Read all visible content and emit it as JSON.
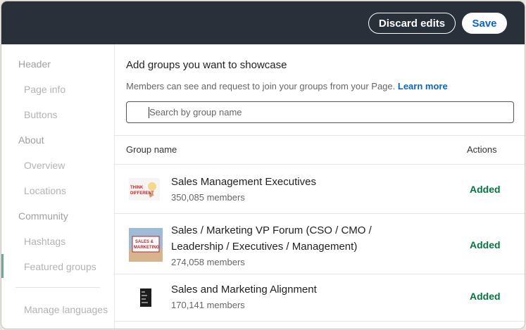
{
  "toolbar": {
    "discard_label": "Discard edits",
    "save_label": "Save"
  },
  "sidebar": {
    "sections": [
      {
        "label": "Header",
        "items": [
          "Page info",
          "Buttons"
        ]
      },
      {
        "label": "About",
        "items": [
          "Overview",
          "Locations"
        ]
      },
      {
        "label": "Community",
        "items": [
          "Hashtags",
          "Featured groups"
        ]
      }
    ],
    "footer_item": "Manage languages",
    "active_item": "Featured groups"
  },
  "main": {
    "title": "Add groups you want to showcase",
    "description": "Members can see and request to join your groups from your Page.",
    "learn_more": "Learn more",
    "search": {
      "placeholder": "Search by group name",
      "value": ""
    },
    "table": {
      "col_name": "Group name",
      "col_actions": "Actions",
      "rows": [
        {
          "name": "Sales Management Executives",
          "members": "350,085 members",
          "action": "Added",
          "thumb_text_1": "THINK",
          "thumb_text_2": "DIFFERENT"
        },
        {
          "name": "Sales / Marketing VP Forum (CSO / CMO / Leadership / Executives / Management)",
          "members": "274,058 members",
          "action": "Added",
          "thumb_text_1": "SALES &",
          "thumb_text_2": "MARKETING"
        },
        {
          "name": "Sales and Marketing Alignment",
          "members": "170,141 members",
          "action": "Added"
        }
      ]
    }
  },
  "colors": {
    "topbar": "#283039",
    "link": "#0a66c2",
    "added": "#057642"
  }
}
